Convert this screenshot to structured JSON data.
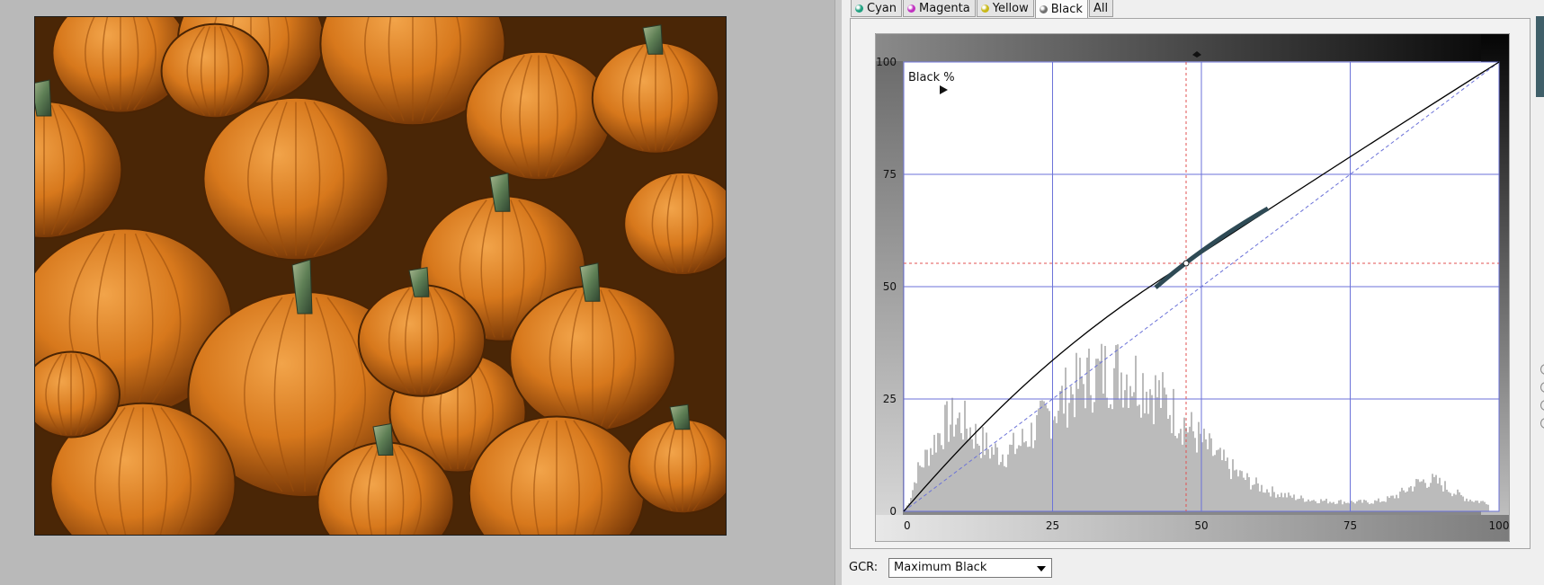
{
  "tabs": [
    {
      "label": "Cyan",
      "dot": "#20a080"
    },
    {
      "label": "Magenta",
      "dot": "#c030c0"
    },
    {
      "label": "Yellow",
      "dot": "#c8b818"
    },
    {
      "label": "Black",
      "dot": "#707070"
    },
    {
      "label": "All",
      "dot": ""
    }
  ],
  "active_tab": "Black",
  "curve": {
    "channel_label": "Black %",
    "x_ticks": [
      "0",
      "25",
      "50",
      "75",
      "100"
    ],
    "y_ticks": [
      "0",
      "25",
      "50",
      "75",
      "100"
    ]
  },
  "gcr": {
    "label": "GCR:",
    "value": "Maximum Black"
  },
  "colors": {
    "grid": "#6b72d8",
    "crosshair": "#e05050",
    "histogram": "#bbbbbb",
    "curve": "#000000",
    "highlight": "#2e4a55"
  }
}
